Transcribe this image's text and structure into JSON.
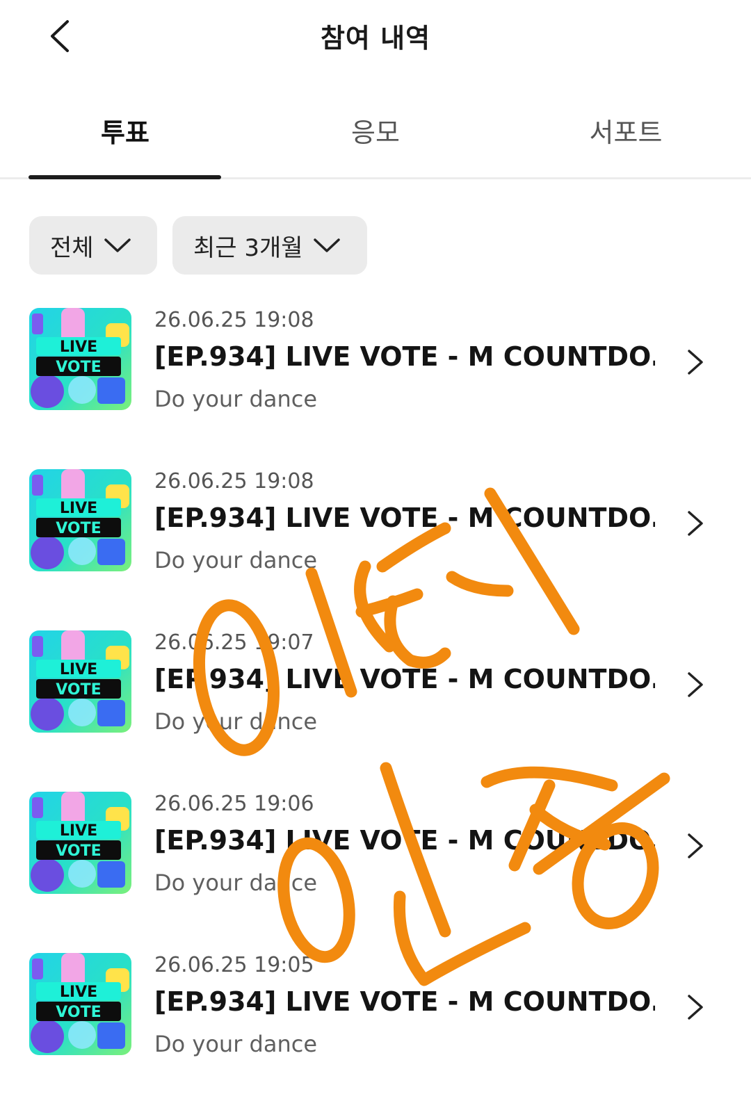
{
  "header": {
    "title": "참여 내역",
    "back_icon": "chevron-left-icon"
  },
  "tabs": [
    {
      "label": "투표",
      "active": true
    },
    {
      "label": "응모",
      "active": false
    },
    {
      "label": "서포트",
      "active": false
    }
  ],
  "filters": [
    {
      "label": "전체",
      "icon": "chevron-down-icon"
    },
    {
      "label": "최근 3개월",
      "icon": "chevron-down-icon"
    }
  ],
  "items": [
    {
      "date": "26.06.25 19:08",
      "title": "[EP.934] LIVE VOTE - M COUNTDO...",
      "subtitle": "Do your dance"
    },
    {
      "date": "26.06.25 19:08",
      "title": "[EP.934] LIVE VOTE - M COUNTDO...",
      "subtitle": "Do your dance"
    },
    {
      "date": "26.06.25 19:07",
      "title": "[EP.934] LIVE VOTE - M COUNTDO...",
      "subtitle": "Do your dance"
    },
    {
      "date": "26.06.25 19:06",
      "title": "[EP.934] LIVE VOTE - M COUNTDO...",
      "subtitle": "Do your dance"
    },
    {
      "date": "26.06.25 19:05",
      "title": "[EP.934] LIVE VOTE - M COUNTDO...",
      "subtitle": "Do your dance"
    }
  ],
  "thumbnail": {
    "line1": "LIVE",
    "line2": "VOTE"
  },
  "overlay": {
    "text": "이티 인증",
    "color": "#f28a0f"
  },
  "colors": {
    "accent": "#1c1c1c",
    "filter_bg": "#ebebeb",
    "divider": "#ececec"
  }
}
